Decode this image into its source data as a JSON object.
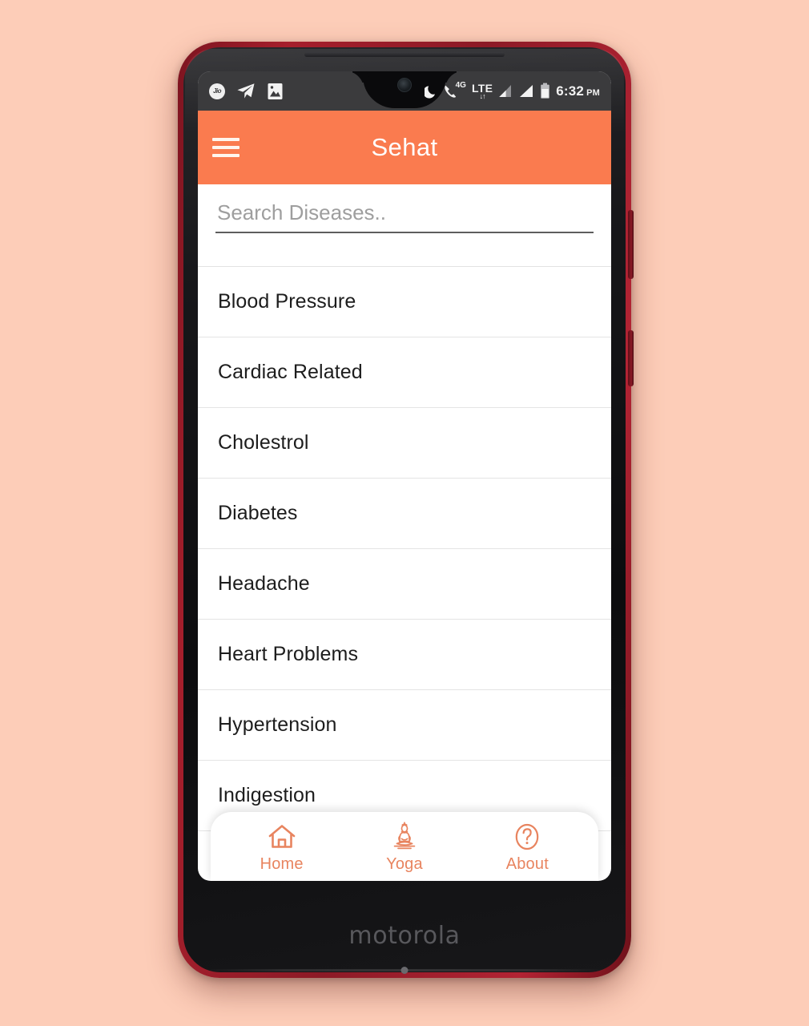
{
  "device": {
    "brand_label": "motorola",
    "frame_color": "#8c1a26",
    "bezel_color": "#121214"
  },
  "theme": {
    "background": "#FDCDB8",
    "accent": "#FA7B4F",
    "nav_text": "#E8845F",
    "status_bar_bg": "#3b3b3d"
  },
  "status_bar": {
    "left_icons": [
      {
        "name": "jio-icon",
        "glyph": "Jio"
      },
      {
        "name": "telegram-icon",
        "glyph": "➤"
      },
      {
        "name": "photo-icon",
        "glyph": "ὛC"
      }
    ],
    "dnd_icon": "do-not-disturb-moon-icon",
    "network_type": "4G",
    "data_type": "LTE",
    "data_arrows": "↓↑",
    "signal_bars": 2,
    "battery_icon": "battery-icon",
    "time": "6:32",
    "am_pm": "PM"
  },
  "app_bar": {
    "menu_icon": "hamburger-menu-icon",
    "title": "Sehat"
  },
  "search": {
    "placeholder": "Search Diseases..",
    "value": ""
  },
  "diseases": [
    {
      "label": "Blood Pressure"
    },
    {
      "label": "Cardiac Related"
    },
    {
      "label": "Cholestrol"
    },
    {
      "label": "Diabetes"
    },
    {
      "label": "Headache"
    },
    {
      "label": "Heart Problems"
    },
    {
      "label": "Hypertension"
    },
    {
      "label": "Indigestion"
    }
  ],
  "bottom_nav": {
    "items": [
      {
        "label": "Home",
        "icon": "home-icon"
      },
      {
        "label": "Yoga",
        "icon": "meditation-icon"
      },
      {
        "label": "About",
        "icon": "question-mark-icon"
      }
    ]
  }
}
